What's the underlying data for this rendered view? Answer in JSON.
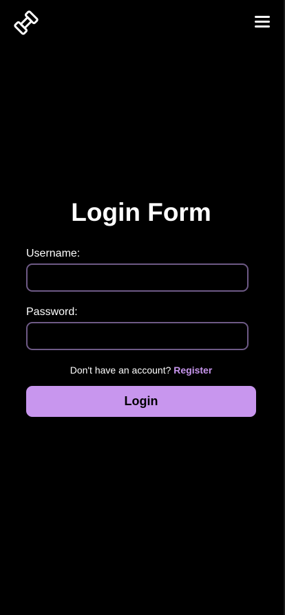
{
  "header": {
    "logo_icon": "dumbbell-icon",
    "menu_icon": "hamburger-menu-icon"
  },
  "form": {
    "title": "Login Form",
    "username_label": "Username:",
    "username_value": "",
    "password_label": "Password:",
    "password_value": "",
    "register_prompt": "Don't have an account?",
    "register_link": "Register",
    "login_button": "Login"
  },
  "colors": {
    "background": "#000000",
    "accent": "#c896ee",
    "field_border": "#6e5a86",
    "text": "#ffffff"
  }
}
